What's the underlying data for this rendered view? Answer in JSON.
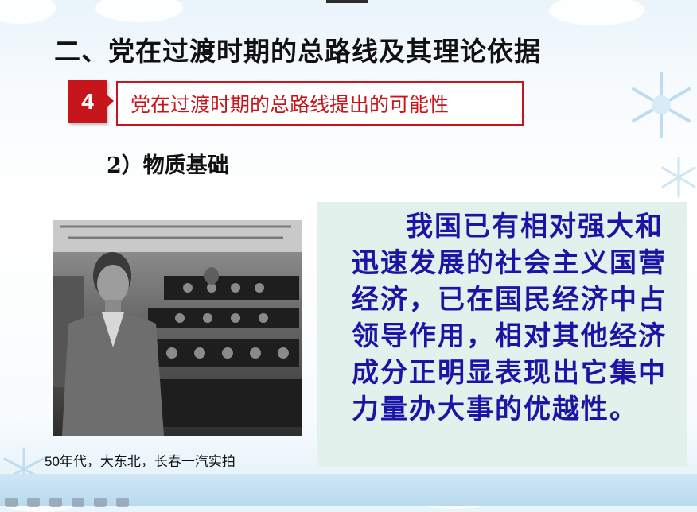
{
  "slide": {
    "title": "二、党在过渡时期的总路线及其理论依据",
    "badge_number": "4",
    "subtitle": "党在过渡时期的总路线提出的可能性",
    "section_heading": "2）物质基础",
    "photo_caption": "50年代，大东北，长春一汽实拍",
    "body_text": "我国已有相对强大和迅速发展的社会主义国营经济，已在国民经济中占领导作用，相对其他经济成分正明显表现出它集中力量办大事的优越性。"
  },
  "toolbar": {
    "icons": [
      "prev-icon",
      "next-icon",
      "pen-icon",
      "pointer-icon",
      "menu-icon",
      "zoom-icon"
    ]
  },
  "colors": {
    "accent_red": "#c8151b",
    "body_text_blue": "#1a15a6",
    "panel_bg": "#e3f1ec"
  }
}
